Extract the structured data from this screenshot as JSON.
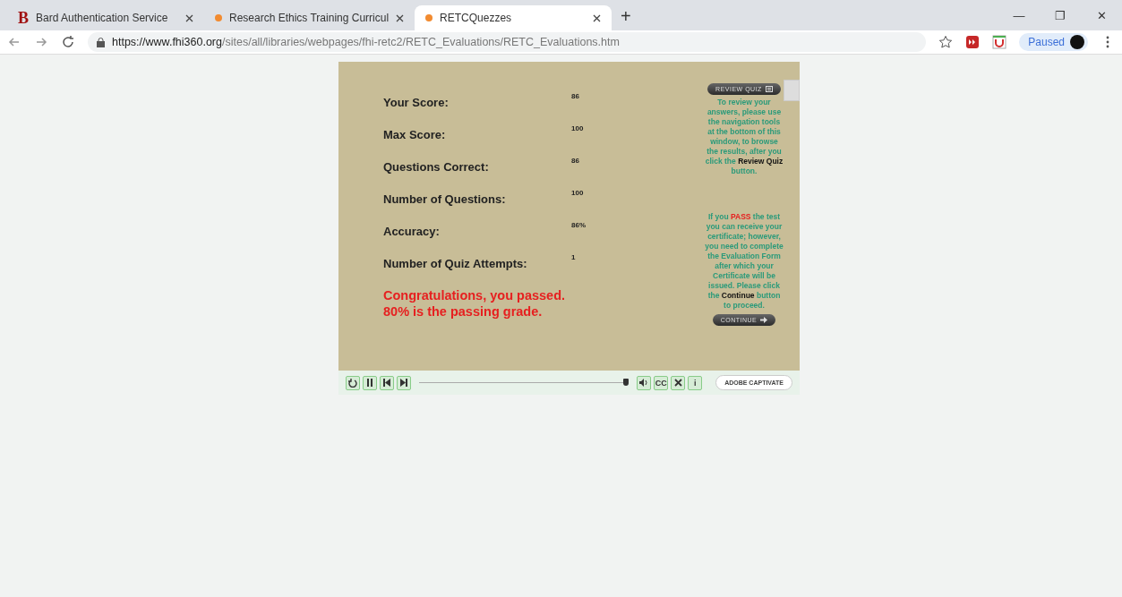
{
  "tabs": [
    {
      "label": "Bard Authentication Service",
      "kind": "logo",
      "logo": "B",
      "selected": false
    },
    {
      "label": "Research Ethics Training Curricul",
      "kind": "dot",
      "selected": false
    },
    {
      "label": "RETCQuezzes",
      "kind": "dot",
      "selected": true
    }
  ],
  "new_tab": "+",
  "window_controls": [
    "—",
    "❐",
    "✕"
  ],
  "address": {
    "host": "https://www.fhi360.org",
    "path": "/sites/all/libraries/webpages/fhi-retc2/RETC_Evaluations/RETC_Evaluations.htm"
  },
  "profile": {
    "label": "Paused"
  },
  "results": [
    {
      "label": "Your Score:",
      "value": "86"
    },
    {
      "label": "Max Score:",
      "value": "100"
    },
    {
      "label": "Questions Correct:",
      "value": "86"
    },
    {
      "label": "Number of Questions:",
      "value": "100"
    },
    {
      "label": "Accuracy:",
      "value": "86%"
    },
    {
      "label": "Number of Quiz Attempts:",
      "value": "1"
    }
  ],
  "message": [
    "Congratulations, you passed.",
    "80% is the passing grade."
  ],
  "review_button": "REVIEW QUIZ",
  "review_note": [
    {
      "text": "To review your answers, please use the navigation tools at the bottom of this window, to browse the results, after you click the ",
      "kind": "plain"
    },
    {
      "text": "Review Quiz",
      "kind": "strong"
    },
    {
      "text": " button.",
      "kind": "plain"
    }
  ],
  "pass_note": [
    {
      "text": "If you ",
      "kind": "plain"
    },
    {
      "text": "PASS",
      "kind": "alert"
    },
    {
      "text": " the test you can receive your certificate; however, you need to complete the Evaluation Form after which your Certificate will be issued.  Please click the ",
      "kind": "plain"
    },
    {
      "text": "Continue",
      "kind": "strong"
    },
    {
      "text": " button to proceed.",
      "kind": "plain"
    }
  ],
  "continue_button": "CONTINUE",
  "player": {
    "progress": {
      "level": 1.0
    },
    "cc": "CC",
    "info": "i",
    "brand": "ADOBE CAPTIVATE"
  }
}
